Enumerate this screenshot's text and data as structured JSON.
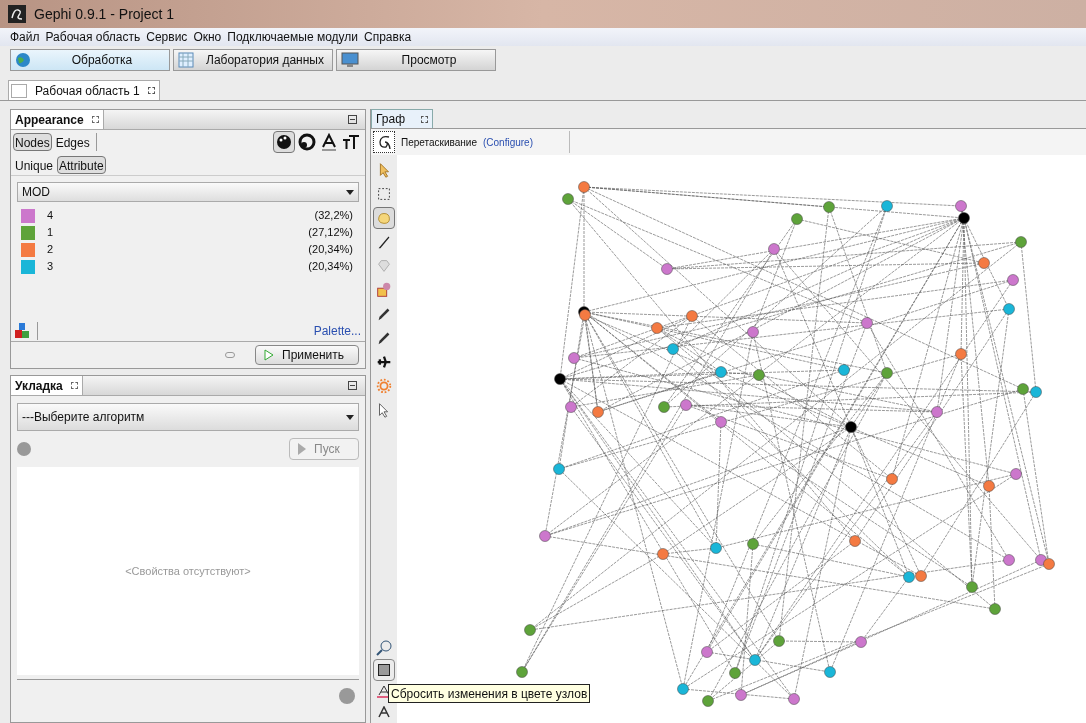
{
  "window": {
    "title": "Gephi 0.9.1 - Project 1"
  },
  "menu": [
    "Файл",
    "Рабочая область",
    "Сервис",
    "Окно",
    "Подключаемые модули",
    "Справка"
  ],
  "perspectives": [
    {
      "label": "Обработка",
      "kind": "globe",
      "selected": true
    },
    {
      "label": "Лаборатория данных",
      "kind": "table",
      "selected": false
    },
    {
      "label": "Просмотр",
      "kind": "monitor",
      "selected": false
    }
  ],
  "workspace_tab": "Рабочая область 1",
  "appearance": {
    "title": "Appearance",
    "element_tabs": [
      {
        "label": "Nodes",
        "selected": true
      },
      {
        "label": "Edges",
        "selected": false
      }
    ],
    "mode_tabs": [
      {
        "label": "Unique",
        "selected": false
      },
      {
        "label": "Attribute",
        "selected": true
      }
    ],
    "attribute": "MOD",
    "partitions": [
      {
        "label": "4",
        "share": "(32,2%)",
        "color": "#cc77cc"
      },
      {
        "label": "1",
        "share": "(27,12%)",
        "color": "#5ea33a"
      },
      {
        "label": "2",
        "share": "(20,34%)",
        "color": "#f47a42"
      },
      {
        "label": "3",
        "share": "(20,34%)",
        "color": "#1ab6d8"
      }
    ],
    "palette_link": "Palette...",
    "apply_button": "Применить"
  },
  "layout": {
    "title": "Укладка",
    "algorithm": "---Выберите алгоритм",
    "run_button": {
      "label": "Пуск",
      "disabled": true
    },
    "empty_text": "<Свойства отсутствуют>"
  },
  "graph": {
    "tab": "Граф",
    "tool_name": "Перетаскивание",
    "configure_link": "(Configure)",
    "tools": [
      {
        "kind": "pointer",
        "selected": false
      },
      {
        "kind": "rect-select",
        "selected": false
      },
      {
        "kind": "drag",
        "selected": true
      },
      {
        "kind": "brush",
        "selected": false
      },
      {
        "kind": "diamond",
        "selected": false
      },
      {
        "kind": "painter",
        "selected": false
      },
      {
        "kind": "pencil",
        "selected": false
      },
      {
        "kind": "pencil",
        "selected": false
      },
      {
        "kind": "plane",
        "selected": false
      },
      {
        "kind": "sun",
        "selected": false
      },
      {
        "kind": "help",
        "selected": false
      }
    ],
    "tooltip": "Сбросить изменения в цвете узлов"
  }
}
